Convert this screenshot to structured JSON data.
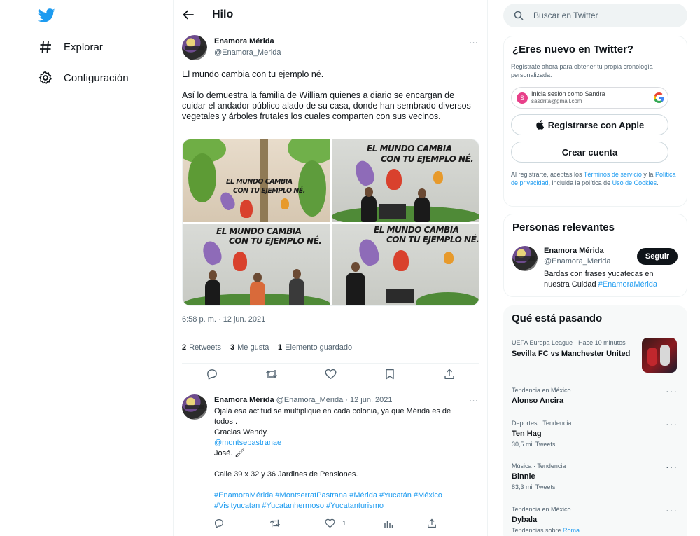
{
  "nav": {
    "explore": "Explorar",
    "settings": "Configuración"
  },
  "header": {
    "title": "Hilo"
  },
  "tweet": {
    "author_name": "Enamora Mérida",
    "author_handle": "@Enamora_Merida",
    "more": "···",
    "line1": "El mundo cambia con tu ejemplo né.",
    "line2": "Así lo demuestra la familia de William quienes a diario se encargan de cuidar el andador público alado de su casa, donde han sembrado diversos vegetales  y árboles frutales los cuales comparten con sus vecinos.",
    "wall_text_a": "EL MUNDO CAMBIA",
    "wall_text_b": "CON TU EJEMPLO NÉ.",
    "wall_tag": "#EnamoraMérida",
    "timestamp": "6:58 p. m. · 12 jun. 2021",
    "stats": {
      "retweets_count": "2",
      "retweets_label": "Retweets",
      "likes_count": "3",
      "likes_label": "Me gusta",
      "saved_count": "1",
      "saved_label": "Elemento guardado"
    }
  },
  "reply": {
    "author_name": "Enamora Mérida",
    "meta": "@Enamora_Merida · 12 jun. 2021",
    "more": "···",
    "line1": "Ojalá esa actitud se multiplique en cada colonia, ya que Mérida es de",
    "line2": "todos .",
    "line3": "Gracias Wendy.",
    "mention": "@montsepastranae",
    "line4": "José. 🖌",
    "line5": "Calle 39 x 32 y 36 Jardines de Pensiones.",
    "hashtags1": "#EnamoraMérida #MontserratPastrana #Mérida #Yucatán #México",
    "hashtags2": "#Visityucatan #Yucatanhermoso #Yucatanturismo",
    "like_count": "1"
  },
  "search": {
    "placeholder": "Buscar en Twitter"
  },
  "signup": {
    "title": "¿Eres nuevo en Twitter?",
    "subtitle": "Regístrate ahora para obtener tu propia cronología personalizada.",
    "google_title": "Inicia sesión como Sandra",
    "google_email": "sasdrita@gmail.com",
    "google_initial": "S",
    "apple_label": "Registrarse con Apple",
    "create_label": "Crear cuenta",
    "legal_1": "Al registrarte, aceptas los ",
    "legal_terms": "Términos de servicio",
    "legal_2": " y la ",
    "legal_privacy": "Política de privacidad",
    "legal_3": ", incluida la política de ",
    "legal_cookies": "Uso de Cookies",
    "legal_4": "."
  },
  "relevant": {
    "title": "Personas relevantes",
    "name": "Enamora Mérida",
    "handle": "@Enamora_Merida",
    "follow_label": "Seguir",
    "bio": "Bardas con frases yucatecas en nuestra Cuidad ",
    "bio_tag": "#EnamoraMérida"
  },
  "trends": {
    "title": "Qué está pasando",
    "items": [
      {
        "context": "UEFA Europa League · Hace 10 minutos",
        "name": "Sevilla FC vs Manchester United",
        "count": ""
      },
      {
        "context": "Tendencia en México",
        "name": "Alonso Ancira",
        "count": ""
      },
      {
        "context": "Deportes · Tendencia",
        "name": "Ten Hag",
        "count": "30,5 mil Tweets"
      },
      {
        "context": "Música · Tendencia",
        "name": "Binnie",
        "count": "83,3 mil Tweets"
      },
      {
        "context": "Tendencia en México",
        "name": "Dybala",
        "count": ""
      }
    ],
    "related_prefix": "Tendencias sobre ",
    "related_link": "Roma",
    "dots": "···"
  },
  "colors": {
    "accent": "#1d9bf0",
    "text": "#0f1419",
    "muted": "#536471",
    "panel": "#f7f9f9"
  },
  "icons": [
    "twitter-logo-icon",
    "hashtag-icon",
    "gear-icon",
    "back-arrow-icon",
    "search-icon",
    "reply-icon",
    "retweet-icon",
    "like-icon",
    "bookmark-icon",
    "share-icon",
    "apple-icon",
    "google-icon"
  ]
}
